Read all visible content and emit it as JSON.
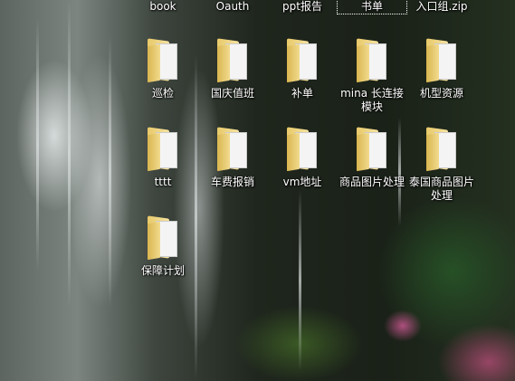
{
  "desktop": {
    "top_row": [
      {
        "label": "book"
      },
      {
        "label": "Oauth"
      },
      {
        "label": "ppt报告"
      },
      {
        "label": "书单",
        "selected": true
      },
      {
        "label": "入口组.zip"
      }
    ],
    "icons": [
      {
        "label": "巡检",
        "icon": "folder-icon"
      },
      {
        "label": "国庆值班",
        "icon": "folder-icon"
      },
      {
        "label": "补单",
        "icon": "folder-icon"
      },
      {
        "label": "mina 长连接模块",
        "icon": "folder-icon"
      },
      {
        "label": "机型资源",
        "icon": "folder-icon"
      },
      {
        "label": "tttt",
        "icon": "folder-icon"
      },
      {
        "label": "车费报销",
        "icon": "folder-icon"
      },
      {
        "label": "vm地址",
        "icon": "folder-icon"
      },
      {
        "label": "商品图片处理",
        "icon": "folder-icon"
      },
      {
        "label": "泰国商品图片处理",
        "icon": "folder-icon"
      },
      {
        "label": "保障计划",
        "icon": "folder-icon"
      }
    ]
  }
}
